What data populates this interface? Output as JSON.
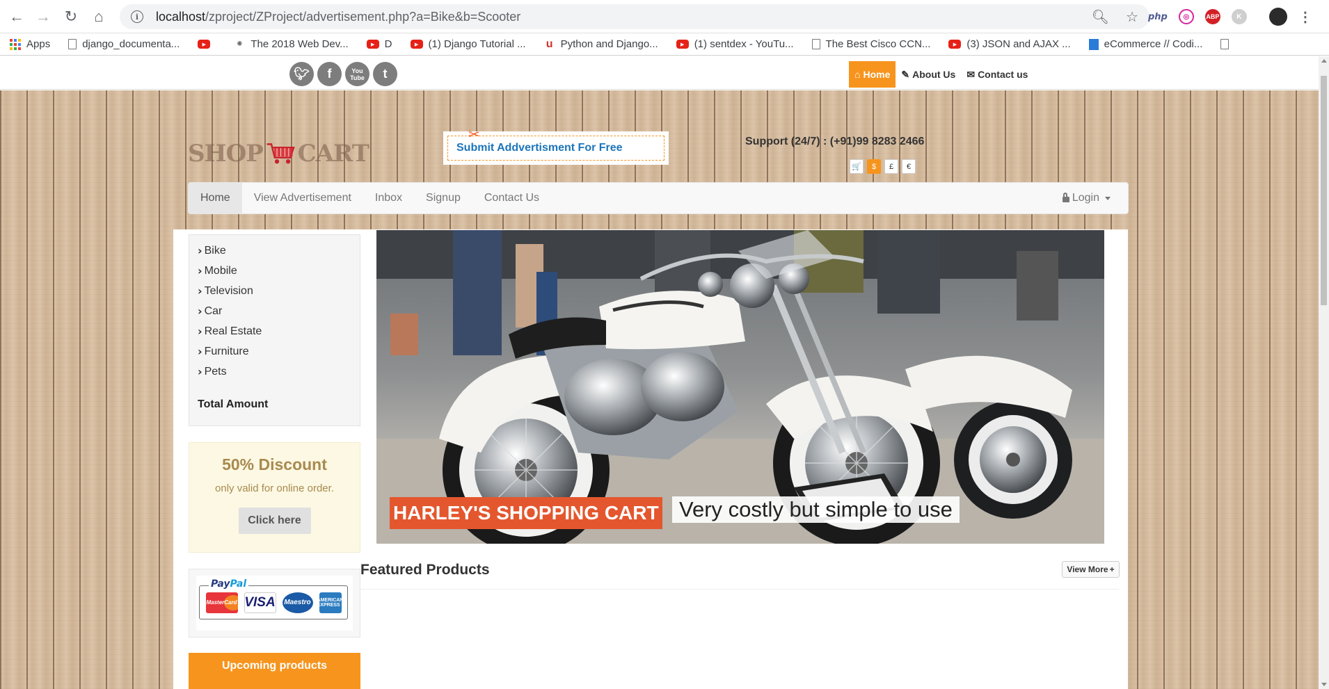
{
  "browser": {
    "url_host": "localhost",
    "url_path": "/zproject/ZProject/advertisement.php?a=Bike&b=Scooter",
    "extensions": [
      "php",
      "ABP",
      "K"
    ],
    "bookmarks": [
      {
        "label": "Apps",
        "icon": "apps-grid-icon"
      },
      {
        "label": "django_documenta...",
        "icon": "document-icon"
      },
      {
        "label": "",
        "icon": "youtube-icon"
      },
      {
        "label": "The 2018 Web Dev...",
        "icon": "webdev-icon"
      },
      {
        "label": "D",
        "icon": "youtube-icon"
      },
      {
        "label": "(1) Django Tutorial ...",
        "icon": "youtube-icon"
      },
      {
        "label": "Python and Django...",
        "icon": "udemy-icon"
      },
      {
        "label": "(1) sentdex - YouTu...",
        "icon": "youtube-icon"
      },
      {
        "label": "The Best Cisco CCN...",
        "icon": "document-icon"
      },
      {
        "label": "(3) JSON and AJAX ...",
        "icon": "youtube-icon"
      },
      {
        "label": "eCommerce // Codi...",
        "icon": "site-icon"
      },
      {
        "label": "",
        "icon": "document-icon"
      }
    ]
  },
  "topbar": {
    "social": [
      "twitter-icon",
      "facebook-icon",
      "youtube-icon",
      "tumblr-icon"
    ],
    "youtube_text": "You Tube",
    "nav": [
      {
        "label": "Home",
        "active": true,
        "icon": "home-icon"
      },
      {
        "label": "About Us",
        "active": false,
        "icon": "edit-icon"
      },
      {
        "label": "Contact us",
        "active": false,
        "icon": "envelope-icon"
      }
    ]
  },
  "header": {
    "logo_left": "SHOP",
    "logo_right": "CART",
    "promo": "Submit Addvertisment For Free",
    "support": "Support (24/7) : (+91)99 8283 2466",
    "currencies": [
      {
        "symbol": "🛒",
        "active": false
      },
      {
        "symbol": "$",
        "active": true
      },
      {
        "symbol": "£",
        "active": false
      },
      {
        "symbol": "€",
        "active": false
      }
    ]
  },
  "mainnav": {
    "items": [
      {
        "label": "Home",
        "active": true
      },
      {
        "label": "View Advertisement",
        "active": false
      },
      {
        "label": "Inbox",
        "active": false
      },
      {
        "label": "Signup",
        "active": false
      },
      {
        "label": "Contact Us",
        "active": false
      }
    ],
    "login": "Login"
  },
  "sidebar": {
    "categories": [
      "Bike",
      "Mobile",
      "Television",
      "Car",
      "Real Estate",
      "Furniture",
      "Pets"
    ],
    "total": "Total Amount",
    "discount": {
      "title": "50% Discount",
      "subtitle": "only valid for online order.",
      "button": "Click here"
    },
    "payment": {
      "paypal_a": "Pay",
      "paypal_b": "Pal",
      "cards": [
        "MasterCard",
        "VISA",
        "Maestro",
        "AMERICAN EXPRESS"
      ]
    },
    "upcoming": "Upcoming products"
  },
  "hero": {
    "caption_primary": "HARLEY'S SHOPPING CART",
    "caption_secondary": "Very costly but simple to use"
  },
  "featured": {
    "title": "Featured Products",
    "view_more": "View More"
  },
  "colors": {
    "accent_orange": "#f7941d",
    "link_blue": "#1b75bb",
    "caption_orange": "#e4572e"
  }
}
